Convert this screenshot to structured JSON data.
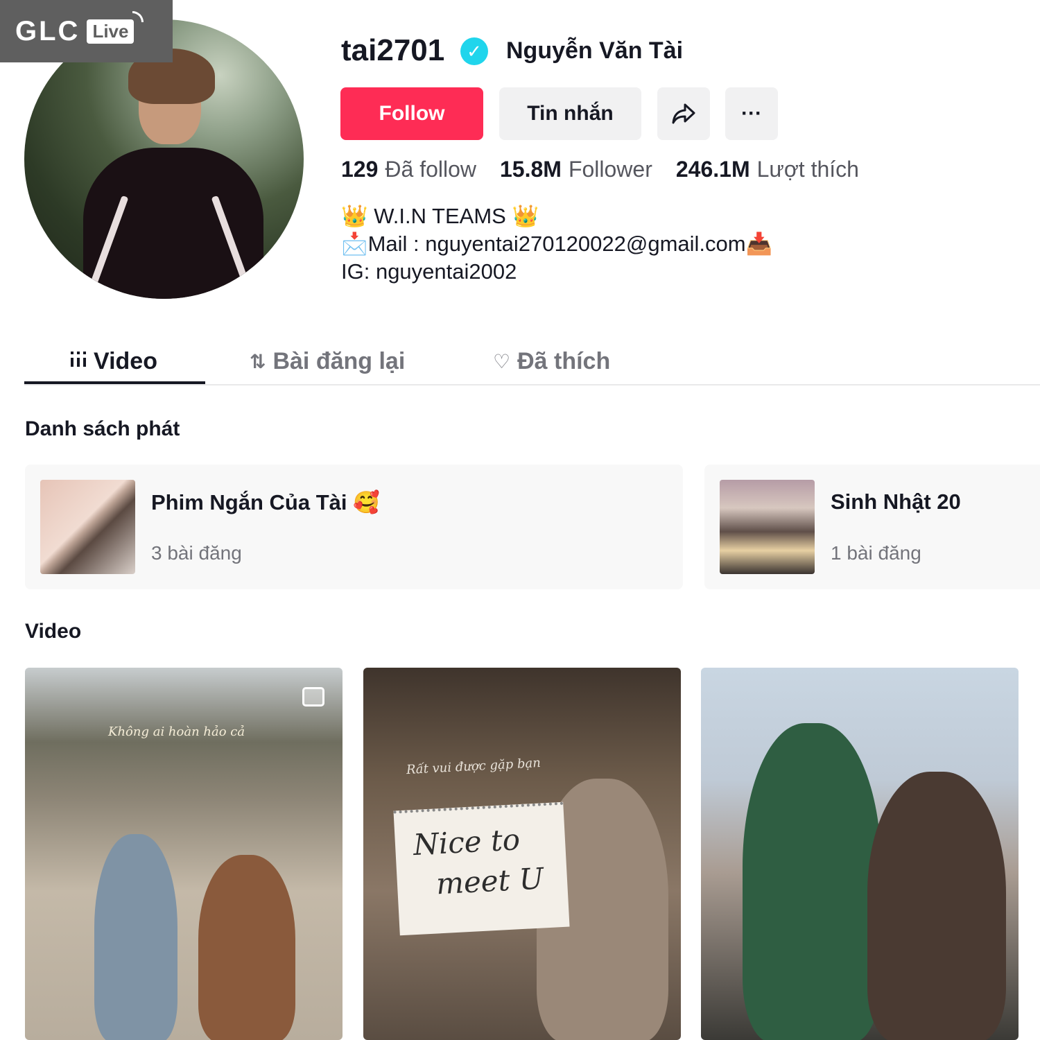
{
  "watermark": {
    "brand": "GLC",
    "live": "Live"
  },
  "profile": {
    "username": "tai2701",
    "verified_mark": "✓",
    "nickname": "Nguyễn Văn Tài"
  },
  "actions": {
    "follow_label": "Follow",
    "message_label": "Tin nhắn",
    "share_icon": "share-icon",
    "more_label": "···"
  },
  "stats": {
    "following_count": "129",
    "following_label": "Đã follow",
    "followers_count": "15.8M",
    "followers_label": "Follower",
    "likes_count": "246.1M",
    "likes_label": "Lượt thích"
  },
  "bio": {
    "line1": "👑 W.I.N TEAMS 👑",
    "line2": "📩Mail : nguyentai270120022@gmail.com📥",
    "line3": "IG: nguyentai2002"
  },
  "tabs": [
    {
      "label": "Video",
      "icon": "grid-icon",
      "active": true
    },
    {
      "label": "Bài đăng lại",
      "icon": "repost-icon",
      "active": false
    },
    {
      "label": "Đã thích",
      "icon": "heart-icon",
      "active": false
    }
  ],
  "playlists": {
    "section_title": "Danh sách phát",
    "items": [
      {
        "title": "Phim Ngắn Của Tài 🥰",
        "count": "3 bài đăng"
      },
      {
        "title": "Sinh Nhật 20",
        "count": "1 bài đăng"
      }
    ]
  },
  "videos": {
    "section_title": "Video",
    "items": [
      {
        "caption": "Không ai hoàn hảo cả",
        "type": "photo"
      },
      {
        "caption": "Rất vui được gặp bạn",
        "note_line1": "Nice to",
        "note_line2": "meet U",
        "type": "video"
      },
      {
        "caption": "",
        "type": "video"
      }
    ]
  },
  "colors": {
    "follow_button": "#fe2c55",
    "verified_badge": "#20d5ec",
    "secondary_button": "#f1f1f2",
    "text_primary": "#161823",
    "text_secondary": "#73747b"
  }
}
